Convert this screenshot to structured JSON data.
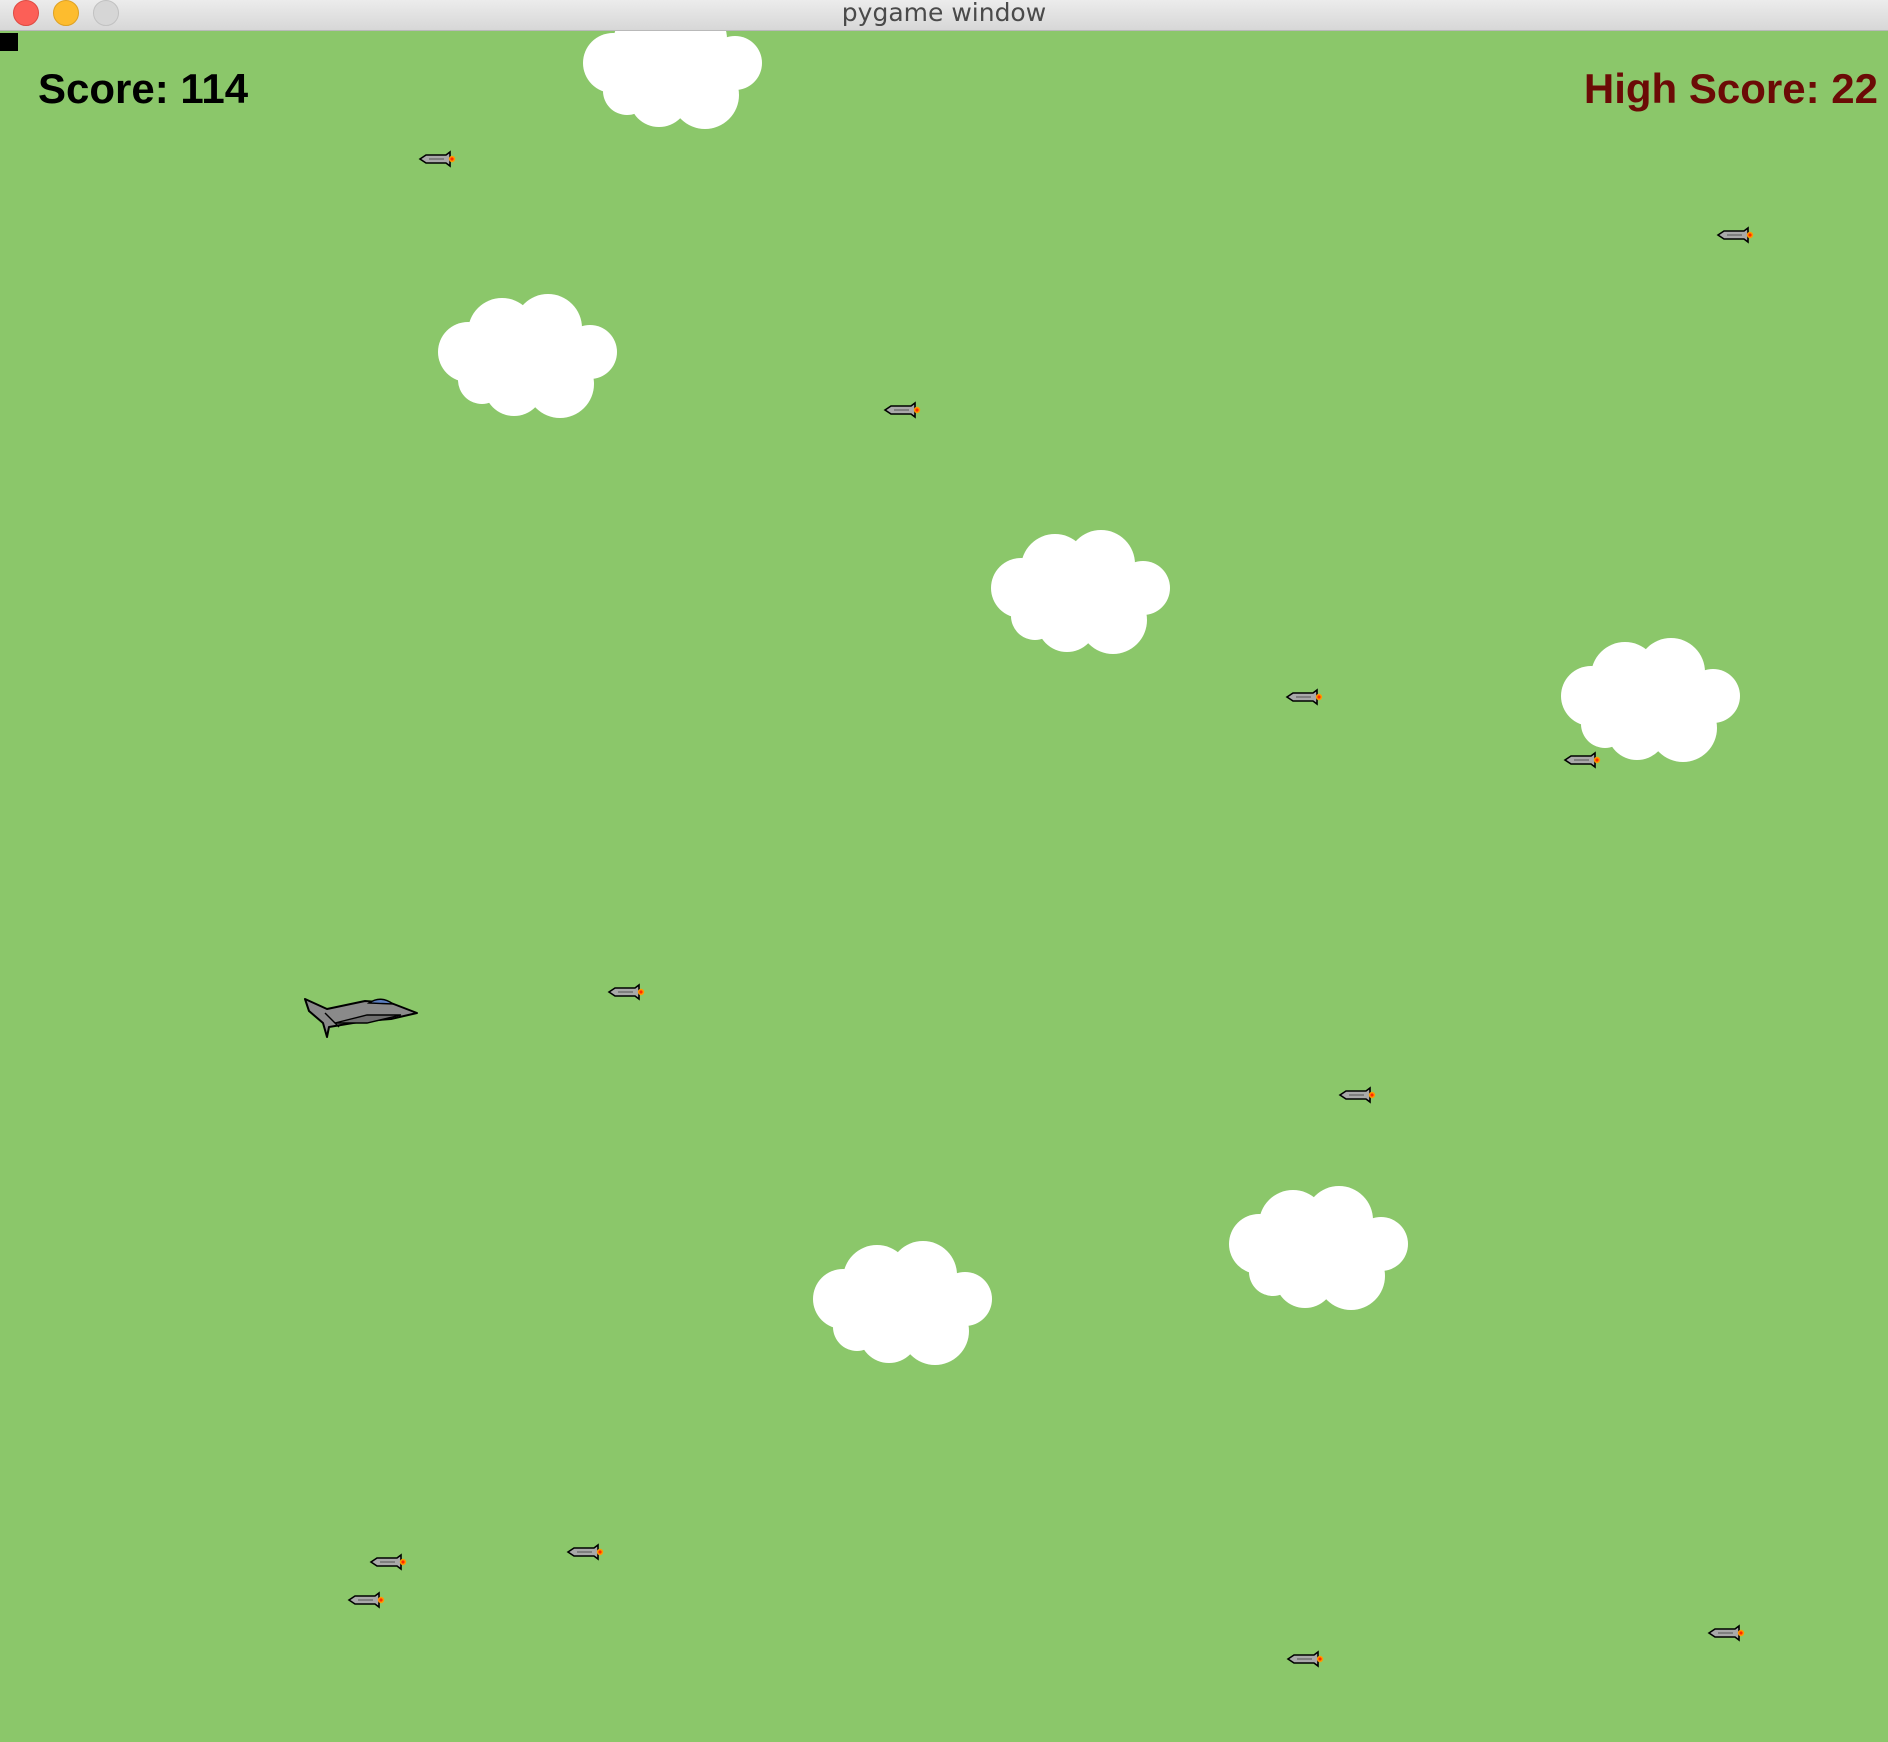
{
  "window": {
    "title": "pygame window"
  },
  "hud": {
    "score_text": "Score: 114",
    "high_score_text": "High Score: 22"
  },
  "colors": {
    "background": "#8bc76a",
    "cloud": "#ffffff",
    "score": "#000000",
    "high_score": "#6b0b06",
    "missile_body": "#a9a9a9",
    "missile_flame": "#ff9a00",
    "jet_body": "#8a8a8a",
    "jet_canopy": "#5a7dbf"
  },
  "icons": {
    "close": "close-icon",
    "minimize": "minimize-icon",
    "maximize": "maximize-icon",
    "player": "jet-icon",
    "enemy": "missile-icon",
    "cloud": "cloud-icon"
  }
}
